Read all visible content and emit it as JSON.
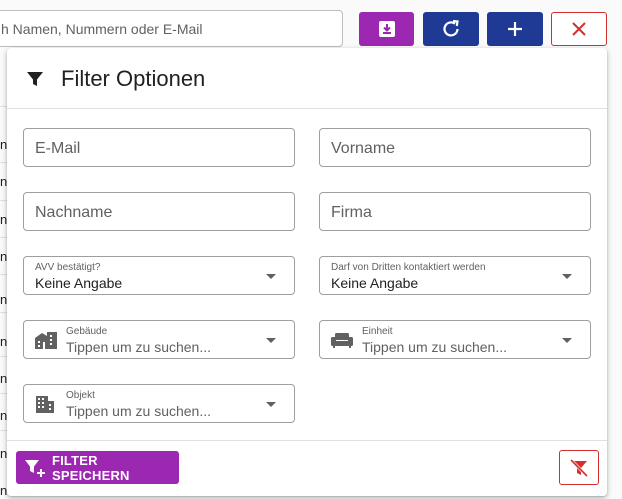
{
  "toolbar": {
    "search_placeholder": "h Namen, Nummern oder E-Mail",
    "download_icon": "download-icon",
    "refresh_icon": "refresh-icon",
    "add_icon": "plus-icon",
    "close_icon": "close-icon"
  },
  "background_rows": [
    "n",
    "n",
    "n",
    "n",
    "n",
    "n",
    "n",
    "n",
    "n",
    "n"
  ],
  "panel": {
    "title": "Filter Optionen",
    "fields": {
      "email_placeholder": "E-Mail",
      "vorname_placeholder": "Vorname",
      "nachname_placeholder": "Nachname",
      "firma_placeholder": "Firma",
      "avv_label": "AVV bestätigt?",
      "avv_value": "Keine Angabe",
      "darf_label": "Darf von Dritten kontaktiert werden",
      "darf_value": "Keine Angabe",
      "gebaeude_label": "Gebäude",
      "gebaeude_placeholder": "Tippen um zu suchen...",
      "einheit_label": "Einheit",
      "einheit_placeholder": "Tippen um zu suchen...",
      "objekt_label": "Objekt",
      "objekt_placeholder": "Tippen um zu suchen..."
    },
    "save_label": "FILTER SPEICHERN"
  },
  "colors": {
    "purple": "#9c27b0",
    "navy": "#1e3a94",
    "red": "#d32f2f"
  }
}
